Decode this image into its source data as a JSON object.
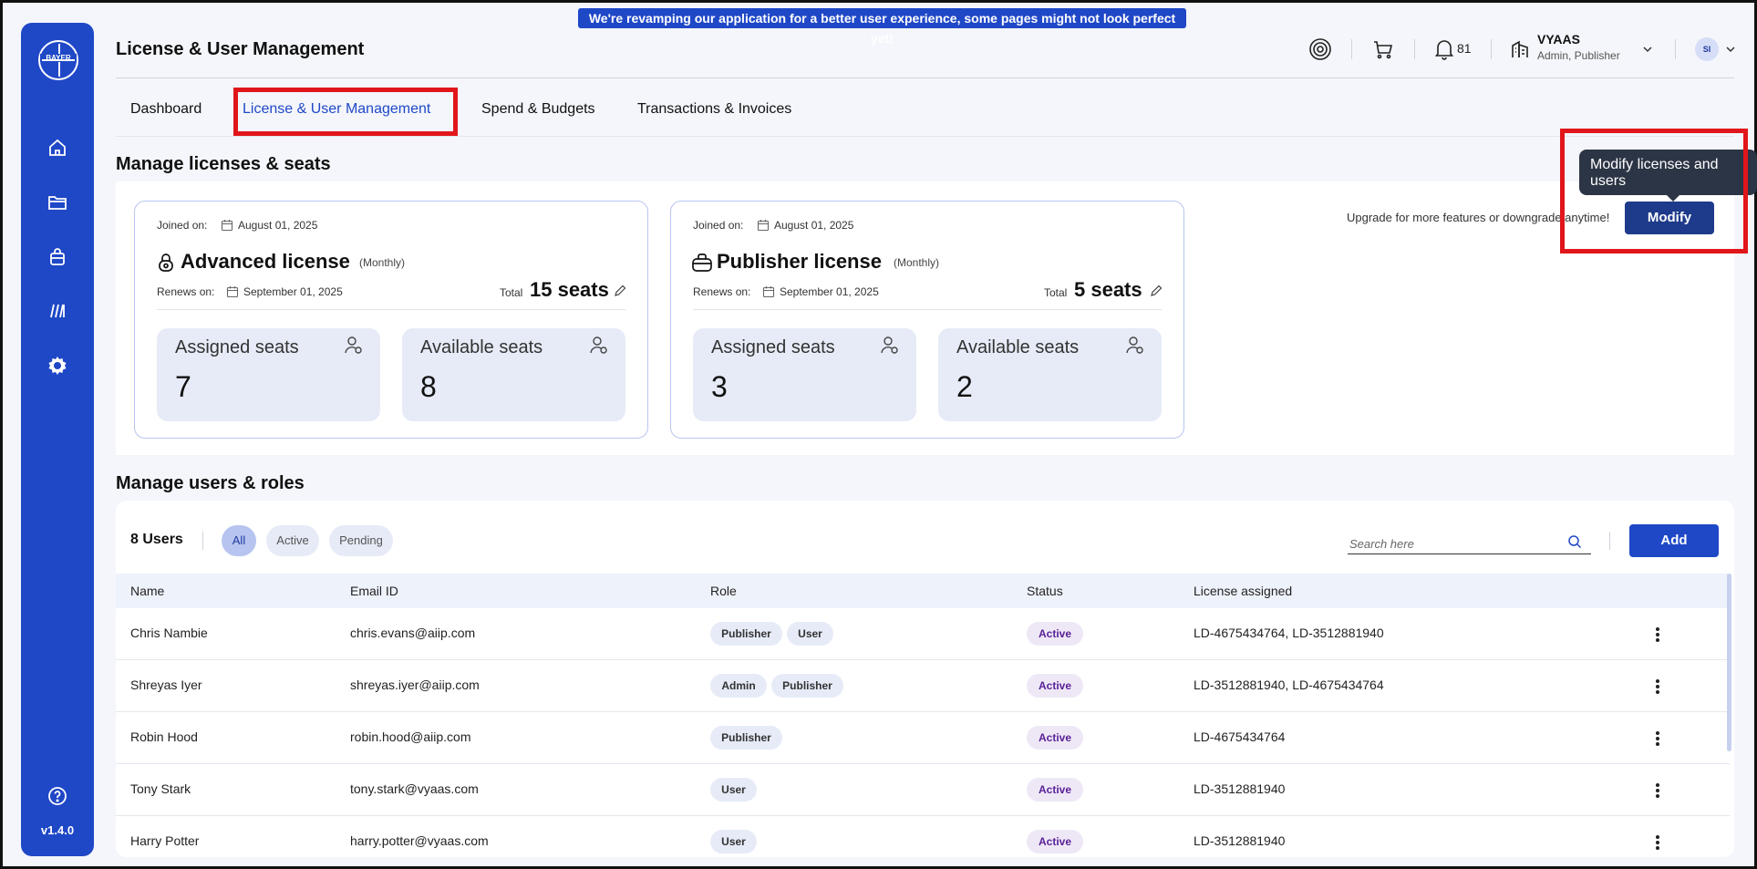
{
  "banner": {
    "text": "We're revamping our application for a better user experience, some pages might not look perfect yet!"
  },
  "sidebar": {
    "logo_text": "BAYER",
    "items": [
      {
        "icon": "home-icon"
      },
      {
        "icon": "folder-icon"
      },
      {
        "icon": "bag-icon"
      },
      {
        "icon": "library-icon"
      },
      {
        "icon": "gear-icon"
      },
      {
        "icon": "help-icon"
      }
    ],
    "version": "v1.4.0"
  },
  "header": {
    "title": "License & User Management",
    "notifications_count": "81",
    "org_name": "VYAAS",
    "org_role": "Admin, Publisher",
    "avatar_initials": "SI"
  },
  "tabs": [
    {
      "label": "Dashboard"
    },
    {
      "label": "License & User Management"
    },
    {
      "label": "Spend & Budgets"
    },
    {
      "label": "Transactions & Invoices"
    }
  ],
  "licenses_section": {
    "title": "Manage licenses & seats",
    "upgrade_text": "Upgrade for more features or downgrade anytime!",
    "modify_label": "Modify",
    "tooltip": "Modify licenses and users",
    "cards": [
      {
        "joined_label": "Joined on:",
        "joined_date": "August 01, 2025",
        "name": "Advanced license",
        "period": "(Monthly)",
        "renews_label": "Renews on:",
        "renews_date": "September 01, 2025",
        "total_label": "Total",
        "total_seats": "15 seats",
        "assigned_label": "Assigned seats",
        "assigned_value": "7",
        "available_label": "Available seats",
        "available_value": "8"
      },
      {
        "joined_label": "Joined on:",
        "joined_date": "August 01, 2025",
        "name": "Publisher license",
        "period": "(Monthly)",
        "renews_label": "Renews on:",
        "renews_date": "September 01, 2025",
        "total_label": "Total",
        "total_seats": "5 seats",
        "assigned_label": "Assigned seats",
        "assigned_value": "3",
        "available_label": "Available seats",
        "available_value": "2"
      }
    ]
  },
  "users_section": {
    "title": "Manage users & roles",
    "count_label": "8 Users",
    "filters": [
      "All",
      "Active",
      "Pending"
    ],
    "search_placeholder": "Search here",
    "add_label": "Add",
    "columns": [
      "Name",
      "Email ID",
      "Role",
      "Status",
      "License assigned"
    ],
    "rows": [
      {
        "name": "Chris Nambie",
        "email": "chris.evans@aiip.com",
        "roles": [
          "Publisher",
          "User"
        ],
        "status": "Active",
        "license": "LD-4675434764, LD-3512881940"
      },
      {
        "name": "Shreyas Iyer",
        "email": "shreyas.iyer@aiip.com",
        "roles": [
          "Admin",
          "Publisher"
        ],
        "status": "Active",
        "license": "LD-3512881940, LD-4675434764"
      },
      {
        "name": "Robin Hood",
        "email": "robin.hood@aiip.com",
        "roles": [
          "Publisher"
        ],
        "status": "Active",
        "license": "LD-4675434764"
      },
      {
        "name": "Tony Stark",
        "email": "tony.stark@vyaas.com",
        "roles": [
          "User"
        ],
        "status": "Active",
        "license": "LD-3512881940"
      },
      {
        "name": "Harry Potter",
        "email": "harry.potter@vyaas.com",
        "roles": [
          "User"
        ],
        "status": "Active",
        "license": "LD-3512881940"
      }
    ]
  },
  "colors": {
    "brand": "#1f48c7",
    "button_dark": "#1e3a8a",
    "highlight": "#e0161b",
    "status_text": "#5a2196"
  }
}
